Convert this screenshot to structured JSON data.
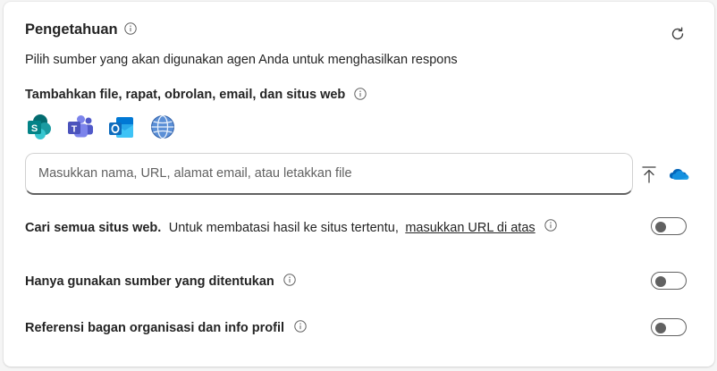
{
  "knowledge": {
    "title": "Pengetahuan",
    "description": "Pilih sumber yang akan digunakan agen Anda untuk menghasilkan respons",
    "add_sources_label": "Tambahkan file, rapat, obrolan, email, dan situs web",
    "sources": [
      {
        "name": "SharePoint",
        "icon": "sharepoint-icon",
        "color": "#038387"
      },
      {
        "name": "Teams",
        "icon": "teams-icon",
        "color": "#5059c9"
      },
      {
        "name": "Outlook",
        "icon": "outlook-icon",
        "color": "#0f6cbd"
      },
      {
        "name": "Web",
        "icon": "globe-icon",
        "color": "#3a6fb8"
      }
    ],
    "search_input": {
      "value": "",
      "placeholder": "Masukkan nama, URL, alamat email, atau letakkan file"
    }
  },
  "settings": [
    {
      "label": "Cari semua situs web.",
      "text": "Untuk membatasi hasil ke situs tertentu,",
      "link": "masukkan URL di atas",
      "enabled": false
    },
    {
      "label": "Hanya gunakan sumber yang ditentukan",
      "enabled": false
    },
    {
      "label": "Referensi bagan organisasi dan info profil",
      "enabled": false
    }
  ],
  "colors": {
    "toggle_off": "#616161",
    "text": "#242424",
    "onedrive": "#0f6cbd"
  }
}
